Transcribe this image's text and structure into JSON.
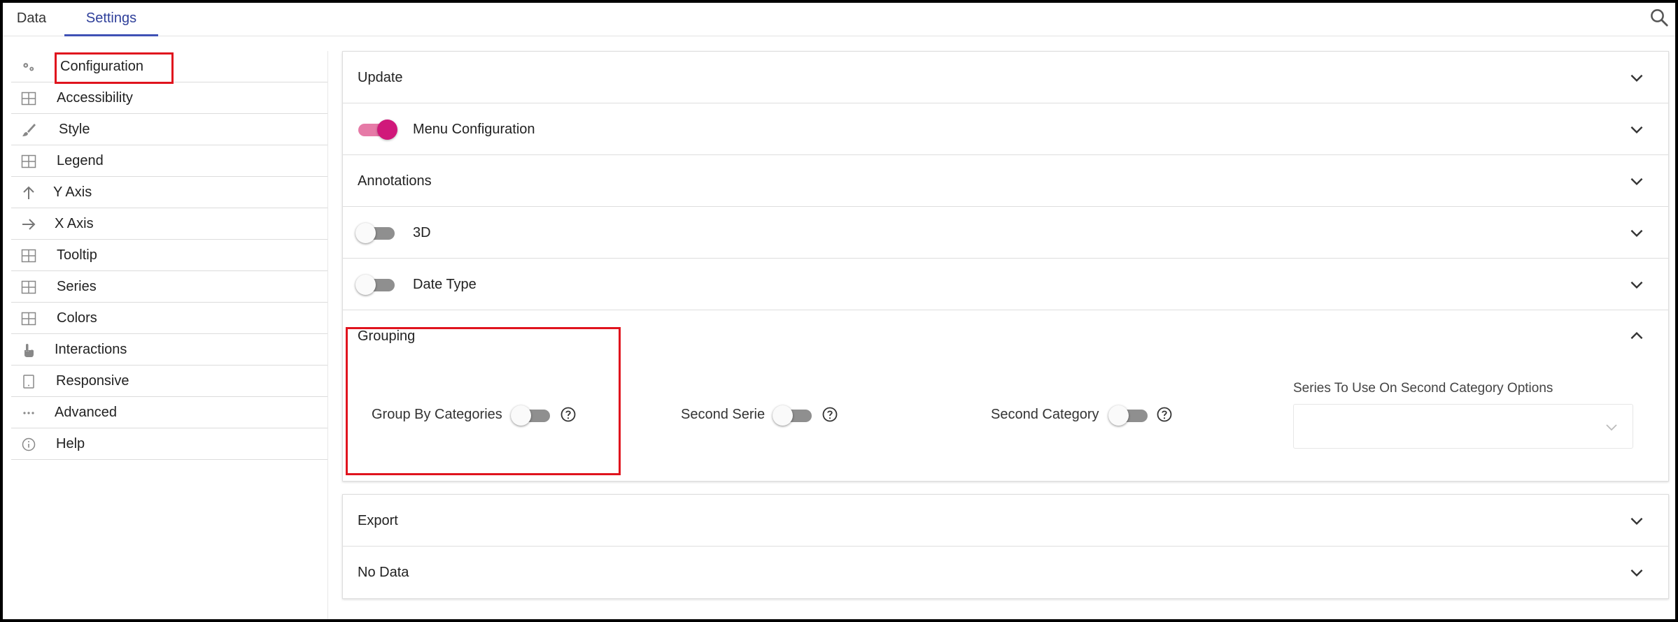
{
  "tabs": {
    "data": "Data",
    "settings": "Settings"
  },
  "sidebar": {
    "items": [
      {
        "label": "Configuration",
        "icon": "gears-icon"
      },
      {
        "label": "Accessibility",
        "icon": "grid-icon"
      },
      {
        "label": "Style",
        "icon": "brush-icon"
      },
      {
        "label": "Legend",
        "icon": "grid-icon"
      },
      {
        "label": "Y Axis",
        "icon": "arrow-up-icon"
      },
      {
        "label": "X Axis",
        "icon": "arrow-right-icon"
      },
      {
        "label": "Tooltip",
        "icon": "grid-icon"
      },
      {
        "label": "Series",
        "icon": "grid-icon"
      },
      {
        "label": "Colors",
        "icon": "grid-icon"
      },
      {
        "label": "Interactions",
        "icon": "hand-pointer-icon"
      },
      {
        "label": "Responsive",
        "icon": "tablet-icon"
      },
      {
        "label": "Advanced",
        "icon": "ellipsis-icon"
      },
      {
        "label": "Help",
        "icon": "info-icon"
      }
    ]
  },
  "panels": {
    "update": "Update",
    "menu_configuration": "Menu Configuration",
    "annotations": "Annotations",
    "three_d": "3D",
    "date_type": "Date Type",
    "grouping": {
      "title": "Grouping",
      "group_by_categories": "Group By Categories",
      "second_serie": "Second Serie",
      "second_category": "Second Category",
      "series_to_use_label": "Series To Use On Second Category Options",
      "series_to_use_value": ""
    },
    "export": "Export",
    "no_data": "No Data"
  },
  "toggles": {
    "menu_configuration": true,
    "three_d": false,
    "date_type": false,
    "group_by_categories": false,
    "second_serie": false,
    "second_category": false
  },
  "colors": {
    "accent": "#3f51b5",
    "toggle_on": "#d0187a",
    "highlight": "#e0141e"
  }
}
